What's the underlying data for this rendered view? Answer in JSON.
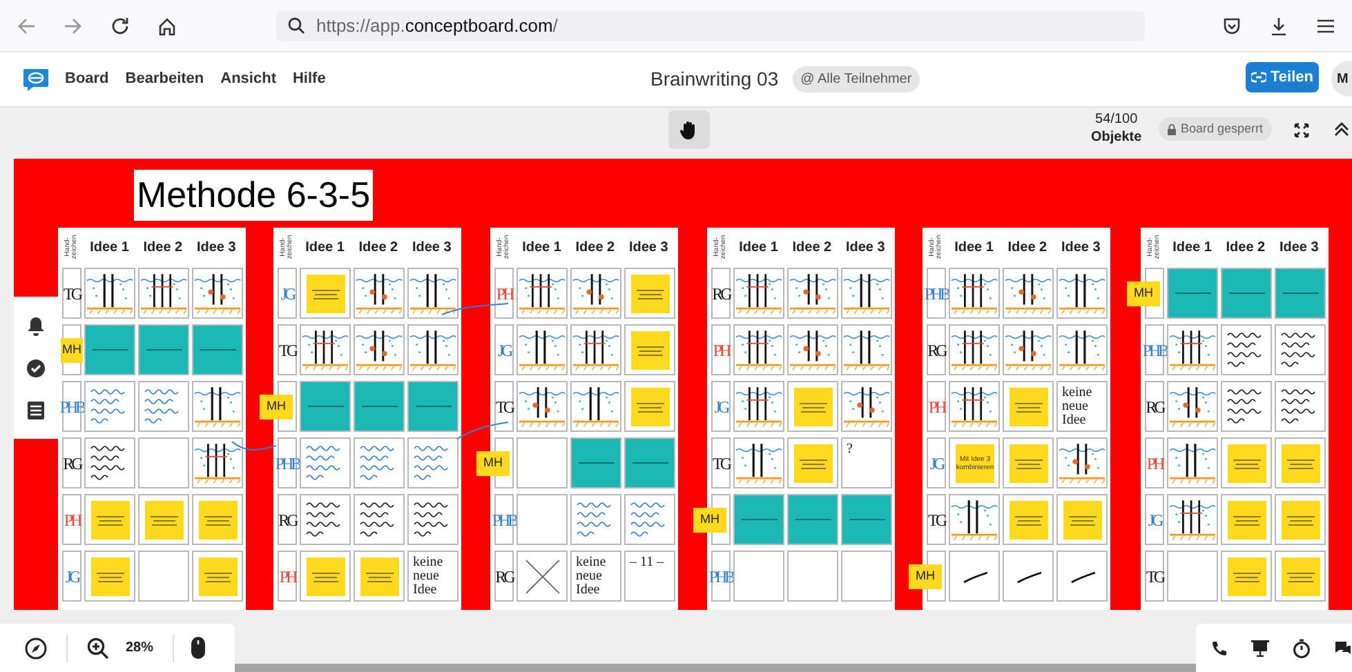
{
  "browser": {
    "url": "https://app.**conceptboard.com**/"
  },
  "app": {
    "menu": [
      "Board",
      "Bearbeiten",
      "Ansicht",
      "Hilfe"
    ],
    "title": "Brainwriting 03",
    "audience": "@ Alle Teilnehmer",
    "share": "Teilen",
    "avatar": "M"
  },
  "toolbar": {
    "objects_count": "54/100",
    "objects_label": "Objekte",
    "lock": "Board gesperrt"
  },
  "board": {
    "title": "Methode 6-3-5",
    "sheets": [
      {
        "hand_label": "Hand- zeichen",
        "columns": [
          "Idee 1",
          "Idee 2",
          "Idee 3"
        ],
        "rows": [
          {
            "marker": {
              "kind": "handwritten",
              "text": "TG",
              "color": "#1a1a1a"
            },
            "cells": [
              {
                "kind": "sketch"
              },
              {
                "kind": "sketch"
              },
              {
                "kind": "sketch"
              }
            ]
          },
          {
            "marker": {
              "kind": "sticker",
              "text": "MH"
            },
            "cells": [
              {
                "kind": "teal"
              },
              {
                "kind": "teal"
              },
              {
                "kind": "teal"
              }
            ]
          },
          {
            "marker": {
              "kind": "handwritten",
              "text": "PHB",
              "color": "#2f7fd6"
            },
            "cells": [
              {
                "kind": "scribble",
                "color": "#2f7fd6"
              },
              {
                "kind": "scribble",
                "color": "#2f7fd6"
              },
              {
                "kind": "sketch"
              }
            ]
          },
          {
            "marker": {
              "kind": "handwritten",
              "text": "RG",
              "color": "#1a1a1a"
            },
            "cells": [
              {
                "kind": "scribble",
                "color": "#1a1a1a"
              },
              {
                "kind": "empty"
              },
              {
                "kind": "sketch"
              }
            ]
          },
          {
            "marker": {
              "kind": "handwritten",
              "text": "PH",
              "color": "#f0442c"
            },
            "cells": [
              {
                "kind": "sticky"
              },
              {
                "kind": "sticky"
              },
              {
                "kind": "sticky"
              }
            ]
          },
          {
            "marker": {
              "kind": "handwritten",
              "text": "JG",
              "color": "#2f7fd6"
            },
            "cells": [
              {
                "kind": "sticky"
              },
              {
                "kind": "empty"
              },
              {
                "kind": "sticky"
              }
            ]
          }
        ]
      },
      {
        "hand_label": "Hand- zeichen",
        "columns": [
          "Idee 1",
          "Idee 2",
          "Idee 3"
        ],
        "rows": [
          {
            "marker": {
              "kind": "handwritten",
              "text": "JG",
              "color": "#2f7fd6"
            },
            "cells": [
              {
                "kind": "sticky"
              },
              {
                "kind": "sketch"
              },
              {
                "kind": "sketch"
              }
            ]
          },
          {
            "marker": {
              "kind": "handwritten",
              "text": "TG",
              "color": "#1a1a1a"
            },
            "cells": [
              {
                "kind": "sketch"
              },
              {
                "kind": "sketch"
              },
              {
                "kind": "sketch"
              }
            ]
          },
          {
            "marker": {
              "kind": "sticker",
              "text": "MH"
            },
            "cells": [
              {
                "kind": "teal"
              },
              {
                "kind": "teal"
              },
              {
                "kind": "teal"
              }
            ]
          },
          {
            "marker": {
              "kind": "handwritten",
              "text": "PHB",
              "color": "#2f7fd6"
            },
            "cells": [
              {
                "kind": "scribble",
                "color": "#2f7fd6"
              },
              {
                "kind": "scribble",
                "color": "#2f7fd6"
              },
              {
                "kind": "scribble",
                "color": "#2f7fd6"
              }
            ]
          },
          {
            "marker": {
              "kind": "handwritten",
              "text": "RG",
              "color": "#1a1a1a"
            },
            "cells": [
              {
                "kind": "scribble",
                "color": "#1a1a1a"
              },
              {
                "kind": "scribble",
                "color": "#1a1a1a"
              },
              {
                "kind": "scribble",
                "color": "#1a1a1a"
              }
            ]
          },
          {
            "marker": {
              "kind": "handwritten",
              "text": "PH",
              "color": "#f0442c"
            },
            "cells": [
              {
                "kind": "sticky"
              },
              {
                "kind": "sticky"
              },
              {
                "kind": "handwritten",
                "text": "keine neue Idee",
                "color": "#1a1a1a"
              }
            ]
          }
        ]
      },
      {
        "hand_label": "Hand- zeichen",
        "columns": [
          "Idee 1",
          "Idee 2",
          "Idee 3"
        ],
        "rows": [
          {
            "marker": {
              "kind": "handwritten",
              "text": "PH",
              "color": "#f0442c"
            },
            "cells": [
              {
                "kind": "sketch"
              },
              {
                "kind": "sketch"
              },
              {
                "kind": "sticky"
              }
            ]
          },
          {
            "marker": {
              "kind": "handwritten",
              "text": "JG",
              "color": "#2f7fd6"
            },
            "cells": [
              {
                "kind": "sketch"
              },
              {
                "kind": "sketch"
              },
              {
                "kind": "sticky"
              }
            ]
          },
          {
            "marker": {
              "kind": "handwritten",
              "text": "TG",
              "color": "#1a1a1a"
            },
            "cells": [
              {
                "kind": "sketch"
              },
              {
                "kind": "sketch"
              },
              {
                "kind": "sticky"
              }
            ]
          },
          {
            "marker": {
              "kind": "sticker",
              "text": "MH"
            },
            "cells": [
              {
                "kind": "empty"
              },
              {
                "kind": "teal"
              },
              {
                "kind": "teal"
              }
            ]
          },
          {
            "marker": {
              "kind": "handwritten",
              "text": "PHB",
              "color": "#2f7fd6"
            },
            "cells": [
              {
                "kind": "empty"
              },
              {
                "kind": "scribble",
                "color": "#2f7fd6"
              },
              {
                "kind": "scribble",
                "color": "#2f7fd6"
              }
            ]
          },
          {
            "marker": {
              "kind": "handwritten",
              "text": "RG",
              "color": "#1a1a1a"
            },
            "cells": [
              {
                "kind": "cross"
              },
              {
                "kind": "handwritten",
                "text": "keine neue Idee",
                "color": "#1a1a1a"
              },
              {
                "kind": "handwritten",
                "text": "– 11 –",
                "color": "#1a1a1a"
              }
            ]
          }
        ]
      },
      {
        "hand_label": "Hand- zeichen",
        "columns": [
          "Idee 1",
          "Idee 2",
          "Idee 3"
        ],
        "rows": [
          {
            "marker": {
              "kind": "handwritten",
              "text": "RG",
              "color": "#1a1a1a"
            },
            "cells": [
              {
                "kind": "sketch"
              },
              {
                "kind": "sketch"
              },
              {
                "kind": "sketch"
              }
            ]
          },
          {
            "marker": {
              "kind": "handwritten",
              "text": "PH",
              "color": "#f0442c"
            },
            "cells": [
              {
                "kind": "sketch"
              },
              {
                "kind": "sketch"
              },
              {
                "kind": "sketch"
              }
            ]
          },
          {
            "marker": {
              "kind": "handwritten",
              "text": "JG",
              "color": "#2f7fd6"
            },
            "cells": [
              {
                "kind": "sketch"
              },
              {
                "kind": "sticky"
              },
              {
                "kind": "sketch"
              }
            ]
          },
          {
            "marker": {
              "kind": "handwritten",
              "text": "TG",
              "color": "#1a1a1a"
            },
            "cells": [
              {
                "kind": "sketch"
              },
              {
                "kind": "sticky"
              },
              {
                "kind": "handwritten",
                "text": "?",
                "color": "#1a1a1a"
              }
            ]
          },
          {
            "marker": {
              "kind": "sticker",
              "text": "MH"
            },
            "cells": [
              {
                "kind": "teal"
              },
              {
                "kind": "teal"
              },
              {
                "kind": "teal"
              }
            ]
          },
          {
            "marker": {
              "kind": "handwritten",
              "text": "PHB",
              "color": "#2f7fd6"
            },
            "cells": [
              {
                "kind": "empty"
              },
              {
                "kind": "empty"
              },
              {
                "kind": "empty"
              }
            ]
          }
        ]
      },
      {
        "hand_label": "Hand- zeichen",
        "columns": [
          "Idee 1",
          "Idee 2",
          "Idee 3"
        ],
        "rows": [
          {
            "marker": {
              "kind": "handwritten",
              "text": "PHB",
              "color": "#2f7fd6"
            },
            "cells": [
              {
                "kind": "sketch"
              },
              {
                "kind": "sketch"
              },
              {
                "kind": "sketch"
              }
            ]
          },
          {
            "marker": {
              "kind": "handwritten",
              "text": "RG",
              "color": "#1a1a1a"
            },
            "cells": [
              {
                "kind": "sketch"
              },
              {
                "kind": "sketch"
              },
              {
                "kind": "sketch"
              }
            ]
          },
          {
            "marker": {
              "kind": "handwritten",
              "text": "PH",
              "color": "#f0442c"
            },
            "cells": [
              {
                "kind": "sketch"
              },
              {
                "kind": "sticky"
              },
              {
                "kind": "handwritten",
                "text": "keine neue Idee",
                "color": "#1a1a1a"
              }
            ]
          },
          {
            "marker": {
              "kind": "handwritten",
              "text": "JG",
              "color": "#2f7fd6"
            },
            "cells": [
              {
                "kind": "sticky",
                "text": "Mit Idee 3 kombinieren"
              },
              {
                "kind": "sticky"
              },
              {
                "kind": "sketch"
              }
            ]
          },
          {
            "marker": {
              "kind": "handwritten",
              "text": "TG",
              "color": "#1a1a1a"
            },
            "cells": [
              {
                "kind": "sketch"
              },
              {
                "kind": "sticky"
              },
              {
                "kind": "sticky"
              }
            ]
          },
          {
            "marker": {
              "kind": "sticker",
              "text": "MH"
            },
            "cells": [
              {
                "kind": "stroke"
              },
              {
                "kind": "stroke"
              },
              {
                "kind": "stroke"
              }
            ]
          }
        ]
      },
      {
        "hand_label": "Hand- zeichen",
        "columns": [
          "Idee 1",
          "Idee 2",
          "Idee 3"
        ],
        "rows": [
          {
            "marker": {
              "kind": "sticker",
              "text": "MH"
            },
            "cells": [
              {
                "kind": "teal"
              },
              {
                "kind": "teal"
              },
              {
                "kind": "teal"
              }
            ]
          },
          {
            "marker": {
              "kind": "handwritten",
              "text": "PHB",
              "color": "#2f7fd6"
            },
            "cells": [
              {
                "kind": "sketch"
              },
              {
                "kind": "scribble",
                "color": "#1a1a1a"
              },
              {
                "kind": "scribble",
                "color": "#1a1a1a"
              }
            ]
          },
          {
            "marker": {
              "kind": "handwritten",
              "text": "RG",
              "color": "#1a1a1a"
            },
            "cells": [
              {
                "kind": "sketch"
              },
              {
                "kind": "scribble",
                "color": "#1a1a1a"
              },
              {
                "kind": "scribble",
                "color": "#1a1a1a"
              }
            ]
          },
          {
            "marker": {
              "kind": "handwritten",
              "text": "PH",
              "color": "#f0442c"
            },
            "cells": [
              {
                "kind": "sketch"
              },
              {
                "kind": "sticky"
              },
              {
                "kind": "sticky"
              }
            ]
          },
          {
            "marker": {
              "kind": "handwritten",
              "text": "JG",
              "color": "#2f7fd6"
            },
            "cells": [
              {
                "kind": "sketch"
              },
              {
                "kind": "sticky"
              },
              {
                "kind": "sticky"
              }
            ]
          },
          {
            "marker": {
              "kind": "handwritten",
              "text": "TG",
              "color": "#1a1a1a"
            },
            "cells": [
              {
                "kind": "empty"
              },
              {
                "kind": "sticky"
              },
              {
                "kind": "sticky"
              }
            ]
          }
        ]
      }
    ]
  },
  "zoom": {
    "level_text": "28%"
  }
}
